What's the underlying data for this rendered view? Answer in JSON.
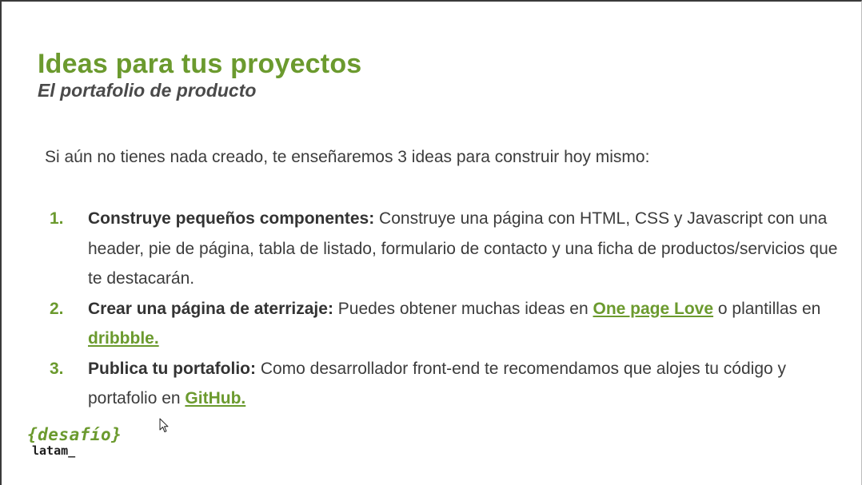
{
  "slide": {
    "title": "Ideas para tus proyectos",
    "subtitle": "El portafolio de producto",
    "intro": "Si aún no tienes nada creado, te enseñaremos 3 ideas para construir hoy mismo:",
    "items": [
      {
        "number": "1.",
        "heading": "Construye pequeños componentes:",
        "text": " Construye una página con HTML, CSS y Javascript con una header, pie de página, tabla de listado, formulario de contacto y una ficha de productos/servicios que te destacarán."
      },
      {
        "number": "2.",
        "heading": "Crear una página de aterrizaje:",
        "text_before": " Puedes obtener muchas ideas en ",
        "link1": "One page Love",
        "text_middle": " o plantillas en ",
        "link2": "dribbble."
      },
      {
        "number": "3.",
        "heading": "Publica tu portafolio:",
        "text_before": " Como desarrollador front-end te recomendamos que alojes tu código y portafolio en ",
        "link": "GitHub."
      }
    ]
  },
  "logo": {
    "top": "{desafío}",
    "bottom": "latam_"
  },
  "colors": {
    "accent": "#6b9a2e",
    "text": "#3c3c3c",
    "subtitle": "#4a4a4a"
  },
  "icons": {
    "cursor": "mouse-pointer-icon"
  }
}
